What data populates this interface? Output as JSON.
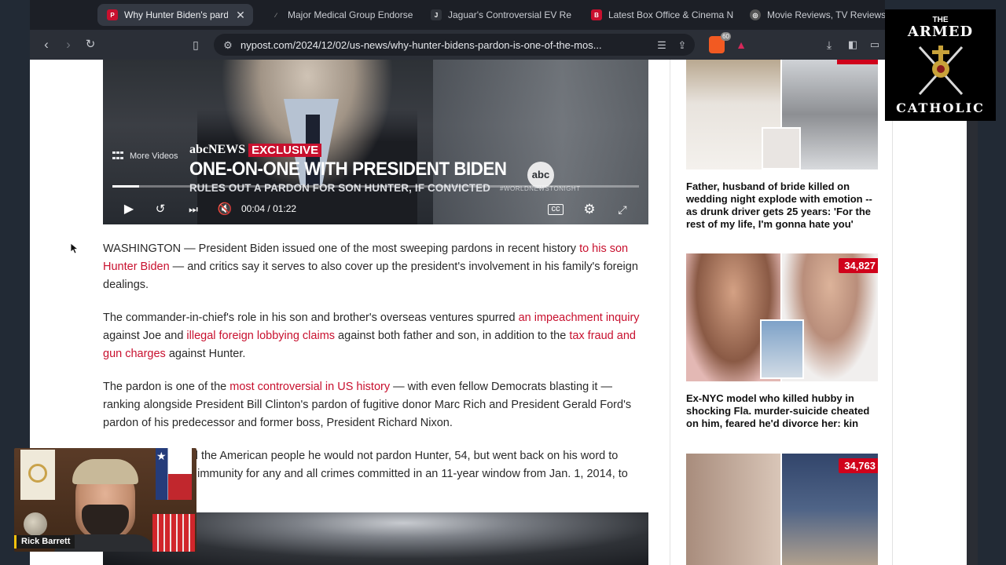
{
  "browser": {
    "tabs": [
      {
        "label": "Why Hunter Biden's pardo",
        "active": true,
        "favicon": "nypost-icon",
        "color": "#c8102e"
      },
      {
        "label": "Major Medical Group Endorse",
        "active": false,
        "favicon": "generic-icon",
        "color": "#1c1f26"
      },
      {
        "label": "Jaguar's Controversial EV Re",
        "active": false,
        "favicon": "jaguar-icon",
        "color": "#1c1f26"
      },
      {
        "label": "Latest Box Office & Cinema N",
        "active": false,
        "favicon": "boxoffice-icon",
        "color": "#c8102e"
      },
      {
        "label": "Movie Reviews, TV Reviews,",
        "active": false,
        "favicon": "rt-icon",
        "color": "#444"
      }
    ],
    "tab_close_glyph": "✕",
    "url": "nypost.com/2024/12/02/us-news/why-hunter-bidens-pardon-is-one-of-the-mos...",
    "brave_count": "60"
  },
  "video": {
    "more_videos_label": "More Videos",
    "network": "abcNEWS",
    "exclusive": "EXCLUSIVE",
    "headline": "ONE-ON-ONE WITH PRESIDENT BIDEN",
    "subheadline": "RULES OUT A PARDON FOR SON HUNTER, IF CONVICTED",
    "logo": "abc",
    "handle": "#WORLDNEWSTONIGHT",
    "current_time": "00:04",
    "separator": "/",
    "duration": "01:22",
    "progress": 0.05
  },
  "article": {
    "paragraphs": [
      [
        {
          "text": "WASHINGTON — President Biden issued one of the most sweeping pardons in recent history "
        },
        {
          "text": "to his son Hunter Biden",
          "link": true
        },
        {
          "text": " — and critics say it serves to also cover up the president's involvement in his family's foreign dealings."
        }
      ],
      [
        {
          "text": "The commander-in-chief's role in his son and brother's overseas ventures spurred "
        },
        {
          "text": "an impeachment inquiry",
          "link": true
        },
        {
          "text": " against Joe and "
        },
        {
          "text": "illegal foreign lobbying claims",
          "link": true
        },
        {
          "text": " against both father and son, in addition to the "
        },
        {
          "text": "tax fraud and gun charges",
          "link": true
        },
        {
          "text": " against Hunter."
        }
      ],
      [
        {
          "text": "The pardon is one of the "
        },
        {
          "text": "most controversial in US history",
          "link": true
        },
        {
          "text": " — with even fellow Democrats blasting it — ranking alongside President Bill Clinton's pardon of fugitive donor Marc Rich and President Gerald Ford's pardon of his predecessor and former boss, President Richard Nixon."
        }
      ],
      [
        {
          "text": "Biden had assured the American people he would not pardon Hunter, 54, but went back on his word to grant federal legal immunity for any and all crimes committed in an 11-year window from Jan. 1, 2014, to Dec. 1, 2024."
        }
      ]
    ]
  },
  "sidebar": {
    "cards": [
      {
        "title": "Father, husband of bride killed on wedding night explode with emotion -- as drunk driver gets 25 years: 'For the rest of my life, I'm gonna hate you'",
        "badge": ""
      },
      {
        "title": "Ex-NYC model who killed hubby in shocking Fla. murder-suicide cheated on him, feared he'd divorce her: kin",
        "badge": "34,827"
      },
      {
        "title": "",
        "badge": "34,763"
      }
    ]
  },
  "overlay": {
    "logo_top": "THE",
    "logo_armed": "ARMED",
    "logo_catholic": "CATHOLIC",
    "streamer_name": "Rick Barrett"
  },
  "colors": {
    "link": "#c8102e",
    "badge": "#d0021b",
    "chrome_bg": "#1c1f26"
  }
}
